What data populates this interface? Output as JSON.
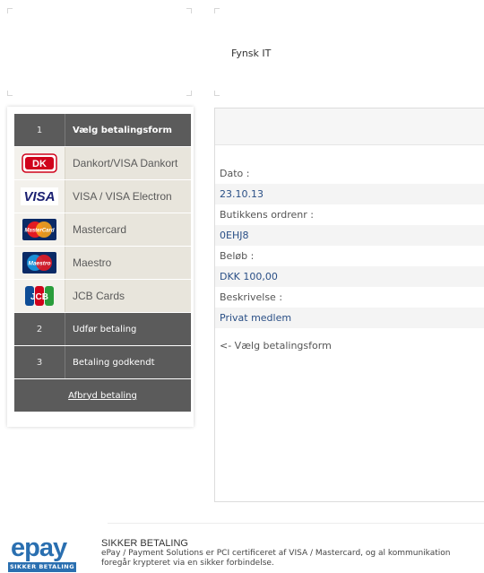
{
  "shop": {
    "name": "Fynsk IT"
  },
  "steps": {
    "step1": {
      "number": "1",
      "label": "Vælg betalingsform"
    },
    "cards": [
      {
        "name": "Dankort/VISA Dankort",
        "icon": "dankort-icon"
      },
      {
        "name": "VISA / VISA Electron",
        "icon": "visa-icon"
      },
      {
        "name": "Mastercard",
        "icon": "mastercard-icon"
      },
      {
        "name": "Maestro",
        "icon": "maestro-icon"
      },
      {
        "name": "JCB Cards",
        "icon": "jcb-icon"
      }
    ],
    "step2": {
      "number": "2",
      "label": "Udfør betaling"
    },
    "step3": {
      "number": "3",
      "label": "Betaling godkendt"
    },
    "cancel_label": "Afbryd betaling"
  },
  "logo_text": {
    "dankort": "DK",
    "visa": "VISA",
    "mastercard": "MasterCard",
    "maestro": "Maestro",
    "jcb": "JCB"
  },
  "order": {
    "date_label": "Dato :",
    "date_value": "23.10.13",
    "order_label": "Butikkens ordrenr :",
    "order_value": "0EHJ8",
    "amount_label": "Beløb :",
    "amount_value": "DKK 100,00",
    "desc_label": "Beskrivelse :",
    "desc_value": "Privat medlem",
    "back_text": "<- Vælg betalingsform"
  },
  "footer": {
    "logo_word": "epay",
    "logo_sub": "SIKKER BETALING",
    "title": "SIKKER BETALING",
    "text": "ePay / Payment Solutions er PCI certificeret af VISA / Mastercard, og al kommunikation foregår krypteret via en sikker forbindelse."
  },
  "colors": {
    "step_dark": "#5b5b5b",
    "card_row": "#e8e5dc",
    "value_text": "#2a4f86",
    "epay_blue": "#2a6fb0"
  }
}
